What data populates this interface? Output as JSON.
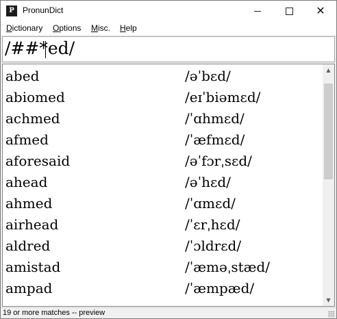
{
  "window": {
    "title": "PronunDict",
    "icon": "pd-app-icon",
    "controls": [
      "minimize-icon",
      "maximize-icon",
      "close-icon"
    ],
    "close_glyph": "✕"
  },
  "menu": {
    "dictionary": {
      "accel": "D",
      "rest": "ictionary"
    },
    "options": {
      "accel": "O",
      "rest": "ptions"
    },
    "misc": {
      "accel": "M",
      "rest": "isc."
    },
    "help": {
      "accel": "H",
      "rest": "elp"
    }
  },
  "search": {
    "value": "/##*ed/"
  },
  "results": [
    {
      "word": "abed",
      "pron": "/əˈbɛd/"
    },
    {
      "word": "abiomed",
      "pron": "/eɪˈbiəmɛd/"
    },
    {
      "word": "achmed",
      "pron": "/ˈɑhmɛd/"
    },
    {
      "word": "afmed",
      "pron": "/ˈæfmɛd/"
    },
    {
      "word": "aforesaid",
      "pron": "/əˈfɔrˌsɛd/"
    },
    {
      "word": "ahead",
      "pron": "/əˈhɛd/"
    },
    {
      "word": "ahmed",
      "pron": "/ˈɑmɛd/"
    },
    {
      "word": "airhead",
      "pron": "/ˈɛrˌhɛd/"
    },
    {
      "word": "aldred",
      "pron": "/ˈɔldrɛd/"
    },
    {
      "word": "amistad",
      "pron": "/ˈæməˌstæd/"
    },
    {
      "word": "ampad",
      "pron": "/ˈæmpæd/"
    }
  ],
  "scrollbar": {
    "position": 0.0
  },
  "status": {
    "text": "19 or more matches -- preview"
  }
}
